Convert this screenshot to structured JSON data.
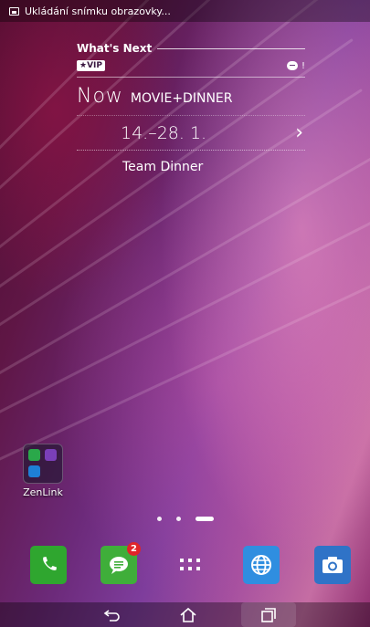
{
  "status_bar": {
    "notification_text": "Ukládání snímku obrazovky..."
  },
  "whats_next": {
    "header": "What's Next",
    "vip_badge": "★VIP",
    "unread_marker": "!",
    "now_label": "Now",
    "event_category": "MOVIE+DINNER",
    "date_range": "14.–28. 1.",
    "event_title": "Team Dinner"
  },
  "folder": {
    "label": "ZenLink"
  },
  "pager": {
    "page_count": 3,
    "current_page": 3
  },
  "dock": {
    "apps": [
      {
        "name": "phone",
        "color": "#2fa62f"
      },
      {
        "name": "messages",
        "color": "#3fae3a",
        "badge": "2"
      },
      {
        "name": "all-apps"
      },
      {
        "name": "browser",
        "color": "#2f8ee0"
      },
      {
        "name": "camera",
        "color": "#2f73c7"
      }
    ]
  },
  "colors": {
    "vip_badge_bg": "#ffffff",
    "notification_badge": "#e0242a"
  }
}
